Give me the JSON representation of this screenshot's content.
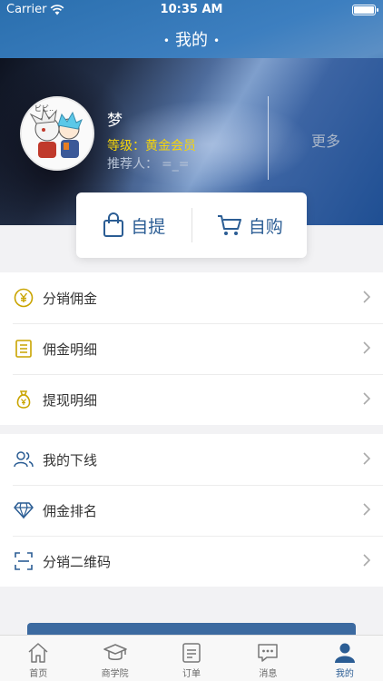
{
  "status": {
    "carrier": "Carrier",
    "time": "10:35 AM"
  },
  "nav": {
    "title": "我的"
  },
  "profile": {
    "name": "梦",
    "level_label": "等级：",
    "level_value": "黄金会员",
    "referrer_label": "推荐人：",
    "referrer_value": "=_=",
    "more_label": "更多"
  },
  "actions": {
    "pickup_label": "自提",
    "purchase_label": "自购"
  },
  "menu_group_1": [
    {
      "label": "分销佣金",
      "icon": "yen-coin-icon"
    },
    {
      "label": "佣金明细",
      "icon": "clipboard-list-icon"
    },
    {
      "label": "提现明细",
      "icon": "money-bag-icon"
    }
  ],
  "menu_group_2": [
    {
      "label": "我的下线",
      "icon": "users-icon"
    },
    {
      "label": "佣金排名",
      "icon": "diamond-icon"
    },
    {
      "label": "分销二维码",
      "icon": "scan-icon"
    }
  ],
  "tabs": [
    {
      "label": "首页",
      "icon": "home-icon"
    },
    {
      "label": "商学院",
      "icon": "graduation-cap-icon"
    },
    {
      "label": "订单",
      "icon": "order-icon"
    },
    {
      "label": "消息",
      "icon": "message-icon"
    },
    {
      "label": "我的",
      "icon": "person-icon",
      "active": true
    }
  ],
  "colors": {
    "accent": "#2b5d94",
    "gold": "#c9a400",
    "level": "#f5d40a"
  }
}
